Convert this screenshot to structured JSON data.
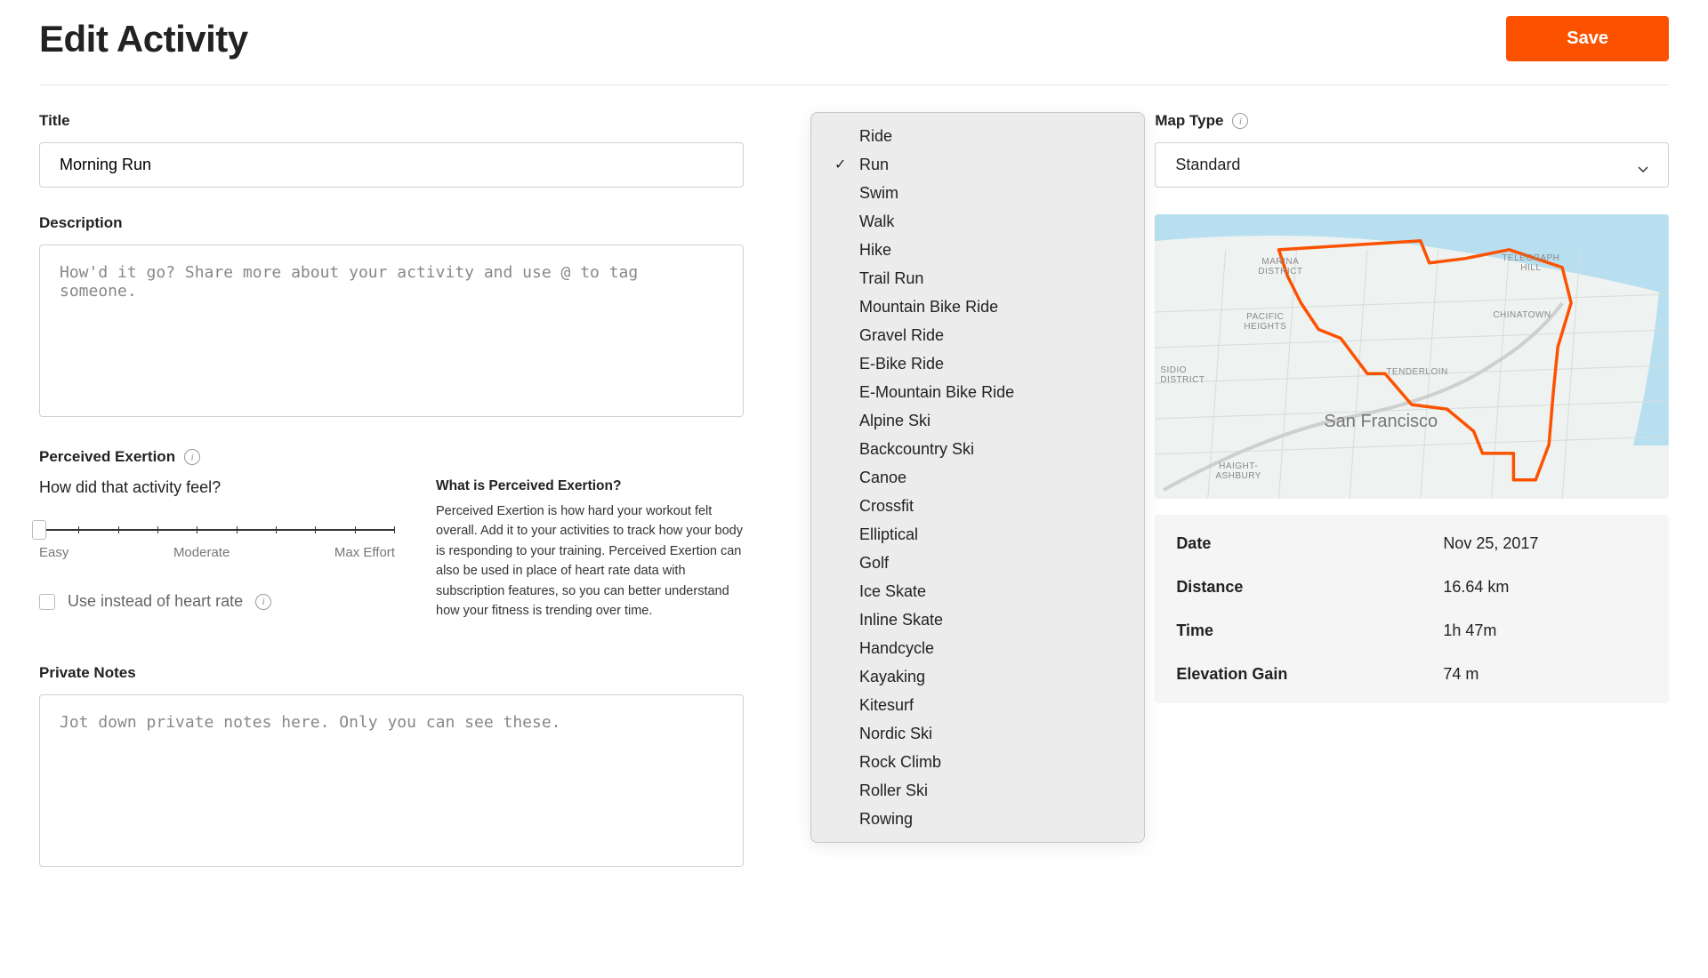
{
  "header": {
    "title": "Edit Activity",
    "save_label": "Save"
  },
  "title_field": {
    "label": "Title",
    "value": "Morning Run"
  },
  "description_field": {
    "label": "Description",
    "placeholder": "How'd it go? Share more about your activity and use @ to tag someone."
  },
  "exertion": {
    "label": "Perceived Exertion",
    "question": "How did that activity feel?",
    "scale": {
      "min_label": "Easy",
      "mid_label": "Moderate",
      "max_label": "Max Effort"
    },
    "checkbox_label": "Use instead of heart rate",
    "help_title": "What is Perceived Exertion?",
    "help_text": "Perceived Exertion is how hard your workout felt overall. Add it to your activities to track how your body is responding to your training. Perceived Exertion can also be used in place of heart rate data with subscription features, so you can better understand how your fitness is trending over time."
  },
  "private_notes": {
    "label": "Private Notes",
    "placeholder": "Jot down private notes here. Only you can see these."
  },
  "sport_dropdown": {
    "selected": "Run",
    "options": [
      "Ride",
      "Run",
      "Swim",
      "Walk",
      "Hike",
      "Trail Run",
      "Mountain Bike Ride",
      "Gravel Ride",
      "E-Bike Ride",
      "E-Mountain Bike Ride",
      "Alpine Ski",
      "Backcountry Ski",
      "Canoe",
      "Crossfit",
      "Elliptical",
      "Golf",
      "Ice Skate",
      "Inline Skate",
      "Handcycle",
      "Kayaking",
      "Kitesurf",
      "Nordic Ski",
      "Rock Climb",
      "Roller Ski",
      "Rowing"
    ]
  },
  "map_type": {
    "label": "Map Type",
    "value": "Standard"
  },
  "map_labels": {
    "marina": "MARINA\nDISTRICT",
    "telegraph": "TELEGRAPH\nHILL",
    "pacific": "PACIFIC\nHEIGHTS",
    "chinatown": "CHINATOWN",
    "district": "DISTRICT",
    "tenderloin": "TENDERLOIN",
    "haight": "HAIGHT-\nASHBURY",
    "city": "San Francisco"
  },
  "stats": {
    "date_label": "Date",
    "date_value": "Nov 25, 2017",
    "distance_label": "Distance",
    "distance_value": "16.64 km",
    "time_label": "Time",
    "time_value": "1h 47m",
    "elev_label": "Elevation Gain",
    "elev_value": "74 m"
  }
}
